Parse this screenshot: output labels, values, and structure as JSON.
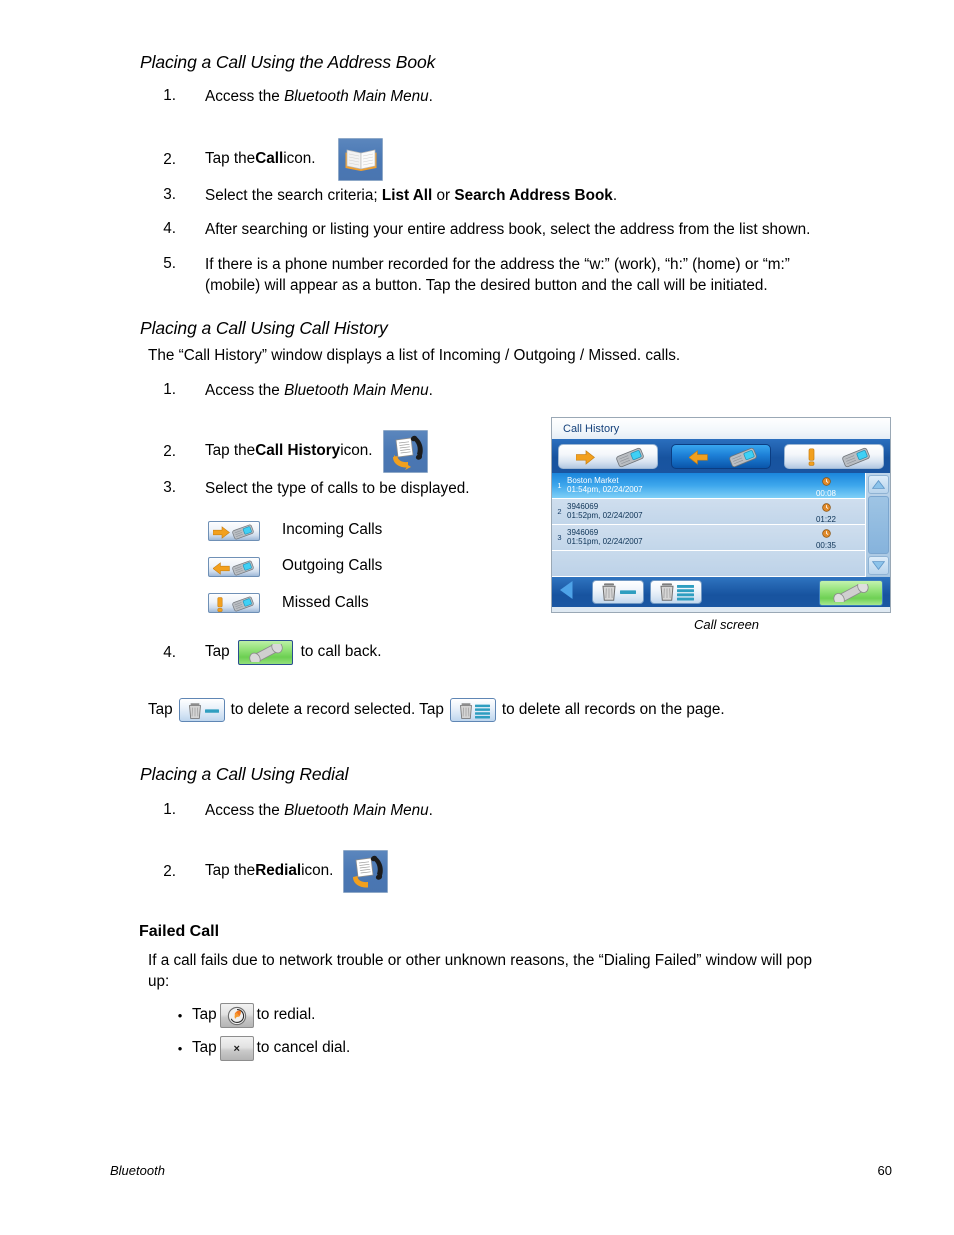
{
  "doc": {
    "sections": [
      {
        "heading": "Placing a Call Using the Address Book",
        "items": [
          "Access the Bluetooth Main Menu.",
          "Tap the Call icon.",
          "Select the search criteria; List All or Search Address Book.",
          "After searching or listing your entire address book, select the address from the list shown.",
          "If there is a phone number recorded for the address the “w:” (work), “h:” (home) or “m:” (mobile) will appear as a button.  Tap the desired button and the call will be initiated."
        ]
      },
      {
        "heading": "Placing a Call Using Call History",
        "intro": "The “Call History” window displays a list of Incoming / Outgoing / Missed. calls.",
        "items": [
          "Access the Bluetooth Main Menu.",
          "Tap the Call History icon.",
          "Select the type of calls to be displayed.",
          "Tap  to call back."
        ]
      },
      {
        "heading": "Placing a Call Using Redial",
        "items": [
          "Access the Bluetooth Main Menu.",
          "Tap the Redial icon."
        ]
      }
    ],
    "item1_prefix": "Access the ",
    "item1_italic": "Bluetooth Main Menu",
    "item1_suffix": ".",
    "tap_the": "Tap the ",
    "icon_word": " icon.",
    "call_word": "Call",
    "call_history_word": "Call History",
    "redial_word": "Redial",
    "step3_prefix": "Select the search criteria; ",
    "step3_listall": "List All",
    "step3_or": " or ",
    "step3_search": "Search Address Book",
    "step3_suffix": ".",
    "step4_addr": "After searching or listing your entire address book, select the address from the list shown.",
    "step5_line1": "If there is a phone number recorded for the address the “w:” (work), “h:” (home) or “m:”",
    "step5_line2": "(mobile) will appear as a button.  Tap the desired button and the call will be initiated.",
    "ch_intro": "The “Call History” window displays a list of Incoming / Outgoing / Missed. calls.",
    "ch_step3": "Select the type of calls to be displayed.",
    "call_types": [
      {
        "label": "Incoming Calls",
        "icon": "arrow-right-phone-icon"
      },
      {
        "label": "Outgoing Calls",
        "icon": "arrow-left-phone-icon"
      },
      {
        "label": "Missed Calls",
        "icon": "exclamation-phone-icon"
      }
    ],
    "ch_step4_pre": "Tap ",
    "ch_step4_post": " to call back.",
    "delete_line": {
      "tap1": "Tap ",
      "mid": " to delete a record selected.  Tap ",
      "end": " to delete all records on the page."
    },
    "failed_call": {
      "heading": "Failed Call",
      "para_line1": "If a call fails due to network trouble or other unknown reasons, the “Dialing Failed” window will pop",
      "para_line2": "up:",
      "bullets": [
        {
          "pre": "Tap ",
          "post": " to redial.",
          "icon": "redial-icon",
          "glyph": ""
        },
        {
          "pre": "Tap ",
          "post": " to cancel dial.",
          "icon": "cancel-dial-icon",
          "glyph": "×"
        }
      ]
    },
    "numbers": [
      "1.",
      "2.",
      "3.",
      "4.",
      "5."
    ]
  },
  "call_screen": {
    "title": "Call History",
    "caption": "Call screen",
    "toolbar": [
      {
        "name": "incoming-calls-tab",
        "selected": false,
        "icon": "arrow-right-phone-icon"
      },
      {
        "name": "outgoing-calls-tab",
        "selected": true,
        "icon": "arrow-left-phone-icon"
      },
      {
        "name": "missed-calls-tab",
        "selected": false,
        "icon": "exclamation-phone-icon"
      }
    ],
    "rows": [
      {
        "index": "1",
        "name": "Boston Market",
        "time": "01:54pm, 02/24/2007",
        "duration": "00:08",
        "selected": true
      },
      {
        "index": "2",
        "name": "3946069",
        "time": "01:52pm, 02/24/2007",
        "duration": "01:22",
        "selected": false
      },
      {
        "index": "3",
        "name": "3946069",
        "time": "01:51pm, 02/24/2007",
        "duration": "00:35",
        "selected": false
      }
    ],
    "bottom": {
      "back": "back-arrow-icon",
      "delete_one": "delete-record-icon",
      "delete_all": "delete-all-records-icon",
      "call_back": "call-back-icon"
    }
  },
  "footer": {
    "left": "Bluetooth",
    "page": "60"
  },
  "colors": {
    "tile_blue": "#4a78b4",
    "accent_orange": "#f2a01e",
    "toolbar_blue": "#17539f",
    "selected_row": "#2a97e6",
    "green": "#7ad45e",
    "teal": "#2e9ec0"
  }
}
